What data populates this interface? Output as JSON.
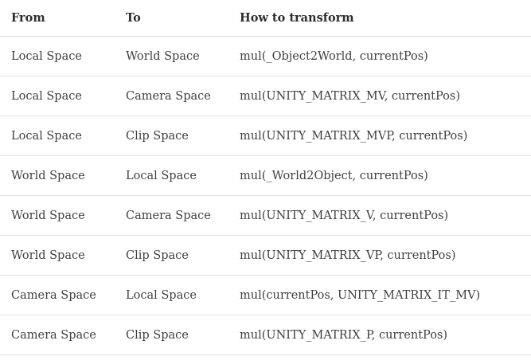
{
  "table": {
    "headers": [
      "From",
      "To",
      "How to transform"
    ],
    "rows": [
      [
        "Local Space",
        "World Space",
        "mul(_Object2World, currentPos)"
      ],
      [
        "Local Space",
        "Camera Space",
        "mul(UNITY_MATRIX_MV, currentPos)"
      ],
      [
        "Local Space",
        "Clip Space",
        "mul(UNITY_MATRIX_MVP, currentPos)"
      ],
      [
        "World Space",
        "Local Space",
        "mul(_World2Object, currentPos)"
      ],
      [
        "World Space",
        "Camera Space",
        "mul(UNITY_MATRIX_V, currentPos)"
      ],
      [
        "World Space",
        "Clip Space",
        "mul(UNITY_MATRIX_VP, currentPos)"
      ],
      [
        "Camera Space",
        "Local Space",
        "mul(currentPos, UNITY_MATRIX_IT_MV)"
      ],
      [
        "Camera Space",
        "Clip Space",
        "mul(UNITY_MATRIX_P, currentPos)"
      ]
    ]
  }
}
